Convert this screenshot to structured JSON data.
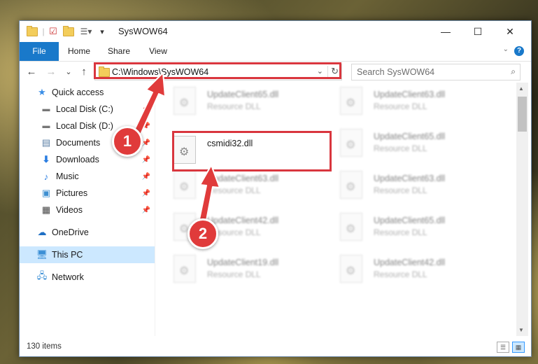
{
  "window": {
    "title": "SysWOW64",
    "minimize": "—",
    "maximize": "☐",
    "close": "✕"
  },
  "ribbon": {
    "tabs": [
      "File",
      "Home",
      "Share",
      "View"
    ],
    "help": "?"
  },
  "navigation": {
    "back": "←",
    "forward": "→",
    "recent": "⌄",
    "up": "↑",
    "address": "C:\\Windows\\SysWOW64",
    "refresh": "↻",
    "search_placeholder": "Search SysWOW64"
  },
  "sidebar": {
    "items": [
      {
        "label": "Quick access",
        "icon": "star-icon"
      },
      {
        "label": "Local Disk (C:)",
        "icon": "drive-icon",
        "pinned": true
      },
      {
        "label": "Local Disk (D:)",
        "icon": "drive-icon",
        "pinned": true
      },
      {
        "label": "Documents",
        "icon": "documents-icon",
        "pinned": true
      },
      {
        "label": "Downloads",
        "icon": "download-icon",
        "pinned": true
      },
      {
        "label": "Music",
        "icon": "music-icon",
        "pinned": true
      },
      {
        "label": "Pictures",
        "icon": "pictures-icon",
        "pinned": true
      },
      {
        "label": "Videos",
        "icon": "videos-icon",
        "pinned": true
      },
      {
        "label": "OneDrive",
        "icon": "cloud-icon"
      },
      {
        "label": "This PC",
        "icon": "computer-icon",
        "selected": true
      },
      {
        "label": "Network",
        "icon": "network-icon"
      }
    ]
  },
  "files": [
    {
      "name": "UpdateClient65.dll",
      "type": "Resource DLL"
    },
    {
      "name": "UpdateClient63.dll",
      "type": "Resource DLL"
    },
    {
      "name": "csmidi32.dll",
      "type": ""
    },
    {
      "name": "UpdateClient65.dll",
      "type": "Resource DLL"
    },
    {
      "name": "UpdateClient63.dll",
      "type": "Resource DLL"
    },
    {
      "name": "UpdateClient63.dll",
      "type": "Resource DLL"
    },
    {
      "name": "UpdateClient42.dll",
      "type": "Resource DLL"
    },
    {
      "name": "UpdateClient65.dll",
      "type": "Resource DLL"
    },
    {
      "name": "UpdateClient19.dll",
      "type": "Resource DLL"
    },
    {
      "name": "UpdateClient42.dll",
      "type": "Resource DLL"
    }
  ],
  "status": {
    "item_count": "130 items"
  },
  "annotations": {
    "step1": "1",
    "step2": "2",
    "highlight_color": "#d9363e"
  }
}
